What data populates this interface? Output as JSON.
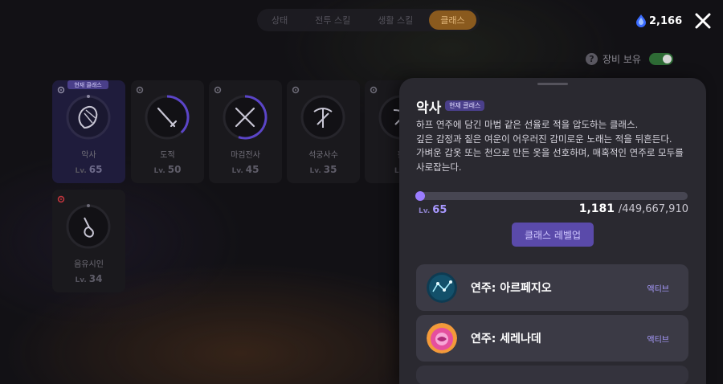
{
  "tabs": [
    {
      "label": "상태",
      "active": false
    },
    {
      "label": "전투 스킬",
      "active": false
    },
    {
      "label": "생활 스킬",
      "active": false
    },
    {
      "label": "클래스",
      "active": true
    }
  ],
  "currency": {
    "amount": "2,166",
    "icon": "blue-gem-icon"
  },
  "equip_toggle": {
    "label": "장비 보유",
    "on": true
  },
  "current_badge": "현재 클래스",
  "classes": [
    {
      "name": "악사",
      "lv_prefix": "Lv.",
      "level": "65",
      "progress": 0.0,
      "selected": true,
      "current": true
    },
    {
      "name": "도적",
      "lv_prefix": "Lv.",
      "level": "50",
      "progress": 0.38
    },
    {
      "name": "마검전사",
      "lv_prefix": "Lv.",
      "level": "45",
      "progress": 0.55
    },
    {
      "name": "석궁사수",
      "lv_prefix": "Lv.",
      "level": "35",
      "progress": 0.0
    },
    {
      "name": "활",
      "lv_prefix": "Lv.",
      "level": "",
      "progress": 0.0
    },
    {
      "name": "음유시인",
      "lv_prefix": "Lv.",
      "level": "34",
      "progress": 0.0,
      "locked": true
    }
  ],
  "panel": {
    "title": "악사",
    "badge": "현재 클래스",
    "description": [
      "하프 연주에 담긴 마법 같은 선율로 적을 압도하는 클래스.",
      "깊은 감정과 짙은 여운이 어우러진 감미로운 노래는 적을 뒤흔든다.",
      "가벼운 갑옷 또는 천으로 만든 옷을 선호하며, 매혹적인 연주로 모두를",
      "사로잡는다."
    ],
    "lv_prefix": "Lv.",
    "level": "65",
    "xp_current": "1,181",
    "xp_max": "/449,667,910",
    "xp_fraction": 0.0,
    "levelup_label": "클래스 레벨업",
    "skills": [
      {
        "name": "연주: 아르페지오",
        "tag": "액티브",
        "icon": "arpeggio-skill-icon"
      },
      {
        "name": "연주: 세레나데",
        "tag": "액티브",
        "icon": "serenade-skill-icon"
      }
    ]
  },
  "colors": {
    "accent": "#8a6bff",
    "tab_active": "#8a5a1e",
    "panel": "#2a2930",
    "selected_card": "#1f1c3c"
  }
}
